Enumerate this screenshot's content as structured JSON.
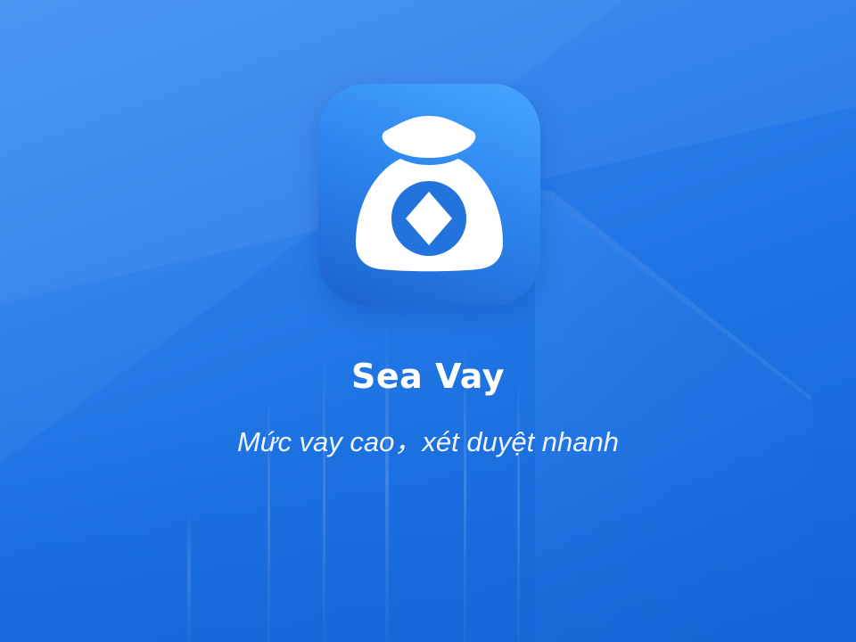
{
  "app": {
    "name": "Sea Vay",
    "tagline": "Mức vay cao，xét duyệt nhanh"
  },
  "icon": {
    "name": "money-bag-icon"
  },
  "colors": {
    "background": "#2b7fec",
    "icon_background": "#2d86ee",
    "icon_glyph": "#ffffff",
    "text": "#ffffff"
  }
}
